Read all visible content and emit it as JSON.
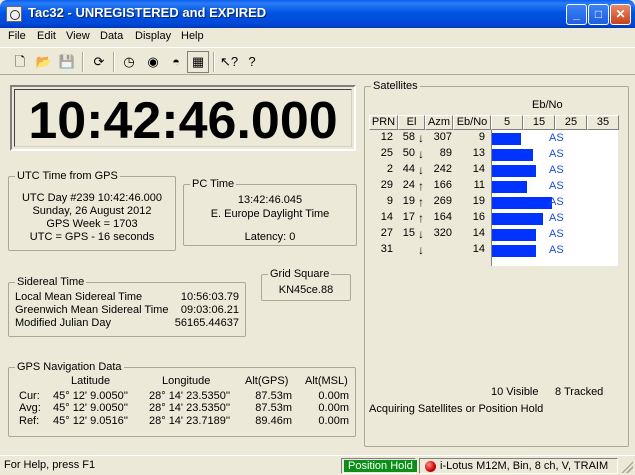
{
  "window": {
    "title": "Tac32 - UNREGISTERED and EXPIRED",
    "minimize": "_",
    "maximize": "□",
    "close": "✕"
  },
  "menu": [
    "File",
    "Edit",
    "View",
    "Data",
    "Display",
    "Help"
  ],
  "toolbar": {
    "icons": [
      "new-file-icon",
      "open-folder-icon",
      "save-icon",
      "refresh-gps-icon",
      "clock-icon",
      "display-icon",
      "sat-icon",
      "grid-icon",
      "context-help-icon",
      "help-icon"
    ],
    "glyphs": [
      "🗋",
      "📂",
      "💾",
      "⟳",
      "◷",
      "◉",
      "◓",
      "▦",
      "↖?",
      "?"
    ]
  },
  "clock": {
    "time": "10:42:46.000"
  },
  "utc": {
    "legend": "UTC Time from GPS",
    "day": "UTC Day #239  10:42:46.000",
    "date": "Sunday, 26 August 2012",
    "week": "GPS Week = 1703",
    "offset": "UTC = GPS - 16 seconds"
  },
  "pc": {
    "legend": "PC Time",
    "time": "13:42:46.045",
    "zone": "E. Europe Daylight Time",
    "latency": "Latency:  0"
  },
  "sidereal": {
    "legend": "Sidereal Time",
    "rows": [
      {
        "label": "Local Mean Sidereal Time",
        "value": "10:56:03.79"
      },
      {
        "label": "Greenwich Mean Sidereal Time",
        "value": "09:03:06.21"
      },
      {
        "label": "Modified Julian Day",
        "value": "56165.44637"
      }
    ]
  },
  "grid": {
    "legend": "Grid Square",
    "value": "KN45ce.88"
  },
  "nav": {
    "legend": "GPS Navigation Data",
    "headers": {
      "lat": "Latitude",
      "lon": "Longitude",
      "alt_gps": "Alt(GPS)",
      "alt_msl": "Alt(MSL)"
    },
    "rows": [
      {
        "label": "Cur:",
        "lat": "45°  12'  9.0050''",
        "lon": "28° 14' 23.5350''",
        "alt_gps": "87.53m",
        "alt_msl": "0.00m"
      },
      {
        "label": "Avg:",
        "lat": "45°  12'  9.0050''",
        "lon": "28° 14' 23.5350''",
        "alt_gps": "87.53m",
        "alt_msl": "0.00m"
      },
      {
        "label": "Ref:",
        "lat": "45°  12'  9.0516''",
        "lon": "28° 14' 23.7189''",
        "alt_gps": "89.46m",
        "alt_msl": "0.00m"
      }
    ]
  },
  "satellites": {
    "legend": "Satellites",
    "ebno_title": "Eb/No",
    "headers": [
      "PRN",
      "El",
      "Azm",
      "Eb/No"
    ],
    "scale": [
      "5",
      "15",
      "25",
      "35"
    ],
    "rows": [
      {
        "prn": "12",
        "el": "58",
        "dir": "↓",
        "azm": "307",
        "ebno": "9",
        "level": 9,
        "tag": "AS"
      },
      {
        "prn": "25",
        "el": "50",
        "dir": "↓",
        "azm": "89",
        "ebno": "13",
        "level": 13,
        "tag": "AS"
      },
      {
        "prn": "2",
        "el": "44",
        "dir": "↓",
        "azm": "242",
        "ebno": "14",
        "level": 14,
        "tag": "AS"
      },
      {
        "prn": "29",
        "el": "24",
        "dir": "↑",
        "azm": "166",
        "ebno": "11",
        "level": 11,
        "tag": "AS"
      },
      {
        "prn": "9",
        "el": "19",
        "dir": "↑",
        "azm": "269",
        "ebno": "19",
        "level": 19,
        "tag": "AS"
      },
      {
        "prn": "14",
        "el": "17",
        "dir": "↑",
        "azm": "164",
        "ebno": "16",
        "level": 16,
        "tag": "AS"
      },
      {
        "prn": "27",
        "el": "15",
        "dir": "↓",
        "azm": "320",
        "ebno": "14",
        "level": 14,
        "tag": "AS"
      },
      {
        "prn": "31",
        "el": "",
        "dir": "↓",
        "azm": "",
        "ebno": "14",
        "level": 14,
        "tag": "AS"
      }
    ],
    "visible": "10 Visible",
    "tracked": "8 Tracked",
    "status": "Acquiring Satellites or Position Hold"
  },
  "status": {
    "help": "For Help, press F1",
    "position": "Position Hold",
    "receiver": "i-Lotus M12M, Bin, 8 ch, V, TRAIM"
  },
  "colors": {
    "bar": "#0033ff",
    "title": "#0054e3",
    "position_hold": "#0c8f18"
  }
}
